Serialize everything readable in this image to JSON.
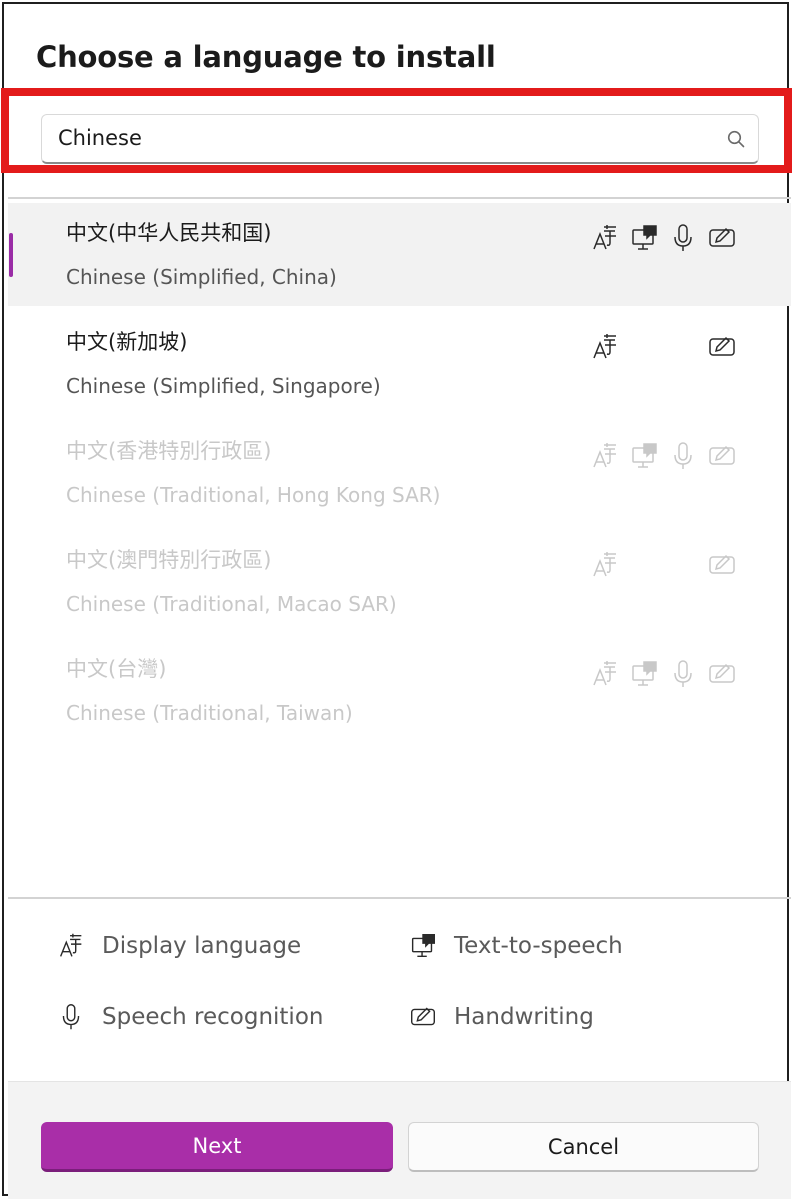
{
  "dialog": {
    "title": "Choose a language to install"
  },
  "search": {
    "value": "Chinese",
    "icon": "search-icon"
  },
  "languages": [
    {
      "native": "中文(中华人民共和国)",
      "english": "Chinese (Simplified, China)",
      "state": "selected",
      "features": [
        "display",
        "tts",
        "speech",
        "handwriting"
      ]
    },
    {
      "native": "中文(新加坡)",
      "english": "Chinese (Simplified, Singapore)",
      "state": "enabled",
      "features": [
        "display",
        "handwriting"
      ]
    },
    {
      "native": "中文(香港特別行政區)",
      "english": "Chinese (Traditional, Hong Kong SAR)",
      "state": "disabled",
      "features": [
        "display",
        "tts",
        "speech",
        "handwriting"
      ]
    },
    {
      "native": "中文(澳門特別行政區)",
      "english": "Chinese (Traditional, Macao SAR)",
      "state": "disabled",
      "features": [
        "display",
        "handwriting"
      ]
    },
    {
      "native": "中文(台灣)",
      "english": "Chinese (Traditional, Taiwan)",
      "state": "disabled",
      "features": [
        "display",
        "tts",
        "speech",
        "handwriting"
      ]
    }
  ],
  "legend": {
    "display": "Display language",
    "tts": "Text-to-speech",
    "speech": "Speech recognition",
    "handwriting": "Handwriting"
  },
  "buttons": {
    "next": "Next",
    "cancel": "Cancel"
  },
  "colors": {
    "accent": "#a92ea8",
    "highlight": "#e31b1b",
    "disabled_text": "#c8c8c8"
  }
}
